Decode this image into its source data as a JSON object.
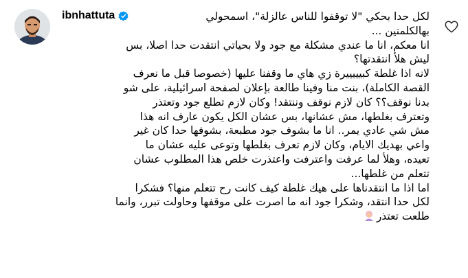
{
  "comment": {
    "username": "ibnhattuta",
    "verified": true,
    "lines": [
      "لكل حدا بحكي \"لا توقفوا للناس عالزلة\"، اسمحولي",
      "بهالكلمتين ...",
      "انا معكم، انا ما عندي مشكلة مع جود ولا بحياتي انتقدت حدا اصلا، بس",
      "ليش هلأ انتقدتها؟",
      "لانه اذا غلطة كبيييييرة زي هاي ما وقفنا عليها (خصوصا قبل ما نعرف",
      "القصة الكاملة)، بنت منا وفينا طالعة بإعلان لصفحة اسرائيلية، على شو",
      "بدنا نوقف؟؟ كان لازم نوقف وننتقد! وكان لازم تطلع جود وتعتذر",
      "وتعترف بغلطها، مش عشانها، بس عشان الكل يكون عارف انه هذا",
      "مش شي عادي يمر.. انا ما بشوف جود مطبعة، بشوفها حدا كان غير",
      "واعي بهديك الايام، وكان لازم تعرف بغلطها وتوعى عليه عشان ما",
      "تعيده، وهلأ لما عرفت واعترفت واعتذرت خلص هذا المطلوب عشان",
      "تتعلم من غلطها...",
      "اما اذا ما انتقدناها على هيك غلطة كيف كانت رح تتعلم منها؟ فشكرا",
      "لكل حدا انتقد، وشكرا جود انه ما اصرت على موقفها وحاولت تبرر، وانما",
      "طلعت تعتذر"
    ],
    "trailing_emoji": "woman-bowing-emoji"
  },
  "icons": {
    "like": "heart-icon",
    "verified": "verified-badge-icon",
    "avatar": "user-avatar"
  },
  "colors": {
    "text": "#000000",
    "verified": "#0095f6",
    "heart_stroke": "#262626",
    "background": "#ffffff"
  }
}
